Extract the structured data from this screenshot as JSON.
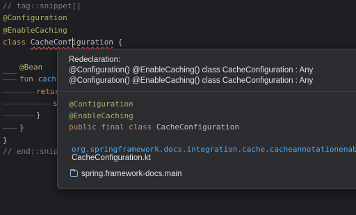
{
  "editor": {
    "line1": "// tag::snippet[]",
    "line2": "@Configuration",
    "line3": "@EnableCaching",
    "line4_kw": "class",
    "line4_name": "CacheConfiguration",
    "line4_brace": "{",
    "line5": "@Bean",
    "line6_kw": "fun",
    "line6_name": "cache",
    "line7": "retur",
    "line8": "s",
    "line9": "}",
    "line10": "}",
    "line11": "}",
    "line12": "// end::snippe"
  },
  "popup": {
    "title": "Redeclaration:",
    "error1": "@Configuration() @EnableCaching() class CacheConfiguration : Any",
    "error2": "@Configuration() @EnableCaching() class CacheConfiguration : Any",
    "annot1": "@Configuration",
    "annot2": "@EnableCaching",
    "decl_kw": "public final class",
    "decl_name": "CacheConfiguration",
    "package": "org.springframework.docs.integration.cache.cacheannotationenab",
    "file": "CacheConfiguration.kt",
    "module": "spring.framework-docs.main",
    "module_icon": "folder-icon"
  }
}
